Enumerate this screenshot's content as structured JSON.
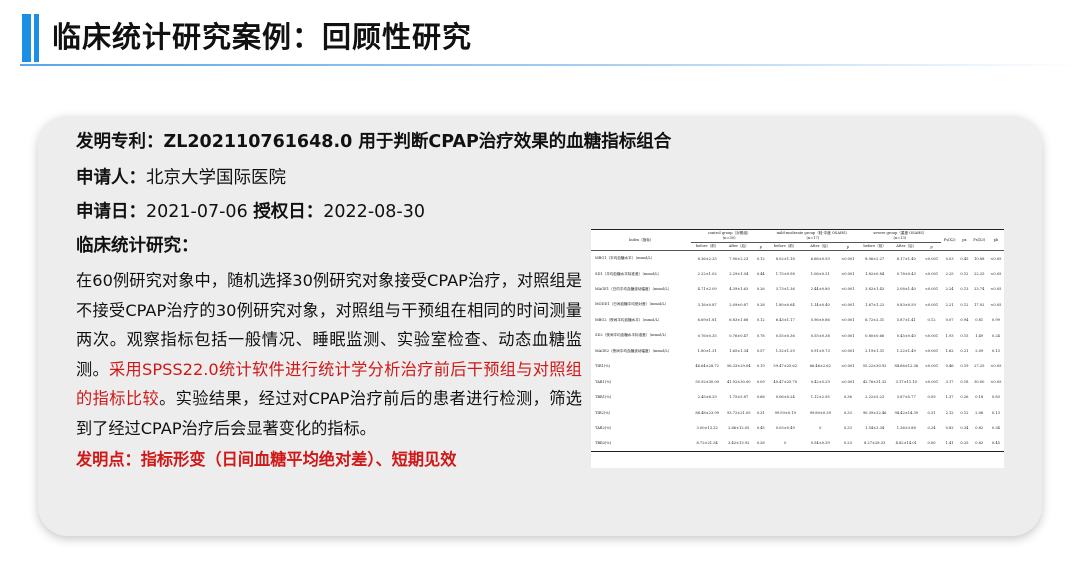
{
  "header": {
    "title": "临床统计研究案例：回顾性研究"
  },
  "patent": {
    "label": "发明专利：",
    "number_and_title": "ZL202110761648.0 用于判断CPAP治疗效果的血糖指标组合",
    "applicant_label": "申请人：",
    "applicant": "北京大学国际医院",
    "apply_date_label": "申请日：",
    "apply_date": "2021-07-06",
    "grant_date_label": "授权日：",
    "grant_date": "2022-08-30"
  },
  "study": {
    "heading": "临床统计研究：",
    "body_part1": "在60例研究对象中，随机选择30例研究对象接受CPAP治疗，对照组是不接受CPAP治疗的30例研究对象，对照组与干预组在相同的时间测量两次。观察指标包括一般情况、睡眠监测、实验室检查、动态血糖监测。",
    "body_highlight": "采用SPSS22.0统计软件进行统计学分析治疗前后干预组与对照组的指标比较",
    "body_part2": "。实验结果，经过对CPAP治疗前后的患者进行检测，筛选到了经过CPAP治疗后会显著变化的指标。",
    "invention_point": "发明点：指标形变（日间血糖平均绝对差）、短期见效"
  },
  "table": {
    "header_index": "Index（指标）",
    "groups": [
      {
        "name": "control group（对照组）",
        "n": "(n=30)"
      },
      {
        "name": "mild-moderate group（轻-中度 OSAHS）",
        "n": "(n=17)"
      },
      {
        "name": "severe group（重度 OSAHS）",
        "n": "(n=13)"
      }
    ],
    "sub_headers": [
      "before（前）",
      "After（后）",
      "p"
    ],
    "extra_headers": [
      "Fs(X2)",
      "px",
      "Fs(X3)",
      "pb"
    ],
    "rows": [
      {
        "index": "MBG1（平均血糖水平）（mmol/L）",
        "c": [
          "8.36±2.33",
          "7.90±2.23",
          "0.12"
        ],
        "m": [
          "8.02±1.18",
          "6.66±0.93",
          "<0.001"
        ],
        "s": [
          "8.06±2.27",
          "6.17±1.40",
          "<0.001"
        ],
        "x": [
          "0.03",
          "0.45",
          "10.88",
          "<0.05"
        ]
      },
      {
        "index": "SD1（平均血糖水平标准差）（mmol/L）",
        "c": [
          "2.22±1.02",
          "2.29±1.04",
          "0.44",
          "1.75±0.98",
          "1.06±0.31",
          "<0.001",
          "1.82±0.84",
          "0.78±0.43",
          "<0.001",
          "2.25",
          "0.12",
          "22.25",
          "<0.05"
        ]
      },
      {
        "index": "MAGE1（日内平均血糖波动幅度）（mmol/L）",
        "c": [
          "4.71±2.09",
          "4.39±1.63",
          "0.26",
          "3.73±1.36",
          "2.44±0.80",
          "<0.001",
          "3.82±1.43",
          "2.08±1.40",
          "<0.001",
          "2.24",
          "0.13",
          "23.74",
          "<0.05"
        ]
      },
      {
        "index": "MODD1（日间血糖平均绝对差）（mmol/L）",
        "c": [
          "3.16±0.87",
          "2.09±0.87",
          "0.28",
          "1.80±0.64",
          "1.14±0.40",
          "<0.001",
          "1.67±1.22",
          "0.83±0.59",
          "<0.001",
          "2.21",
          "0.12",
          "17.92",
          "<0.05"
        ]
      },
      {
        "index": "MBG2（夜间平均血糖水平）（mmol/L）",
        "c": [
          "6.69±1.81",
          "6.83±1.68",
          "0.12",
          "6.43±1.17",
          "5.96±0.86",
          "<0.001",
          "6.72±2.31",
          "5.87±1.41",
          "0.12",
          "0.07",
          "0.94",
          "0.81",
          "0.99"
        ]
      },
      {
        "index": "SD2（夜间平均血糖水平标准差）（mmol/L）",
        "c": [
          "0.76±0.35",
          "0.76±0.47",
          "0.78",
          "0.55±0.36",
          "0.55±0.38",
          "<0.001",
          "0.80±0.66",
          "0.45±0.40",
          "<0.001",
          "1.93",
          "0.15",
          "1.49",
          "0.24"
        ]
      },
      {
        "index": "MAGE2（夜间平均血糖波动幅度）（mmol/L）",
        "c": [
          "1.80±1.31",
          "1.65±1.34",
          "0.57",
          "1.32±1.29",
          "0.91±0.73",
          "<0.001",
          "2.19±1.31",
          "1.22±1.49",
          "<0.001",
          "1.62",
          "0.21",
          "2.09",
          "0.13"
        ]
      },
      {
        "index": "TIR1(%)",
        "c": [
          "46.64±28.72",
          "56.33±29.04",
          "0.19",
          "59.47±25.62",
          "66.46±2.62",
          "<0.001",
          "55.22±30.92",
          "84.66±12.36",
          "<0.001",
          "0.46",
          "0.19",
          "27.25",
          "<0.05"
        ]
      },
      {
        "index": "TAR1(%)",
        "c": [
          "50.92±30.00",
          "41.92±30.00",
          "0.09",
          "40.47±25.70",
          "0.42±5.29",
          "<0.001",
          "42.76±31.32",
          "3.17±11.10",
          "<0.001",
          "3.17",
          "0.18",
          "30.00",
          "<0.05"
        ]
      },
      {
        "index": "TBR1(%)",
        "c": [
          "2.45±6.29",
          "1.75±5.87",
          "0.68",
          "0.06±0.24",
          "1.12±2.95",
          "0.36",
          "2.22±5.23",
          "3.87±5.77",
          "0.09",
          "1.37",
          "0.26",
          "0.18",
          "0.83"
        ]
      },
      {
        "index": "TIR2(%)",
        "c": [
          "88.48±23.99",
          "93.72±21.05",
          "0.31",
          "99.93±0.19",
          "99.80±0.39",
          "0.33",
          "90.39±32.46",
          "94.42±14.39",
          "0.31",
          "2.12",
          "0.12",
          "2.06",
          "0.13"
        ]
      },
      {
        "index": "TAR2(%)",
        "c": [
          "3.00±13.32",
          "2.86±12.05",
          "0.45",
          "0.03±0.49",
          "0",
          "0.33",
          "1.54±3.34",
          "1.36±3.88",
          "0.24",
          "0.82",
          "0.34",
          "0.82",
          "0.34"
        ]
      },
      {
        "index": "TBR2(%)",
        "c": [
          "8.72±21.34",
          "3.42±13.92",
          "0.26",
          "0",
          "0.54±0.39",
          "0.23",
          "8.27±28.33",
          "4.82±14.01",
          "0.00",
          "1.41",
          "0.25",
          "0.82",
          "0.45"
        ]
      }
    ]
  }
}
